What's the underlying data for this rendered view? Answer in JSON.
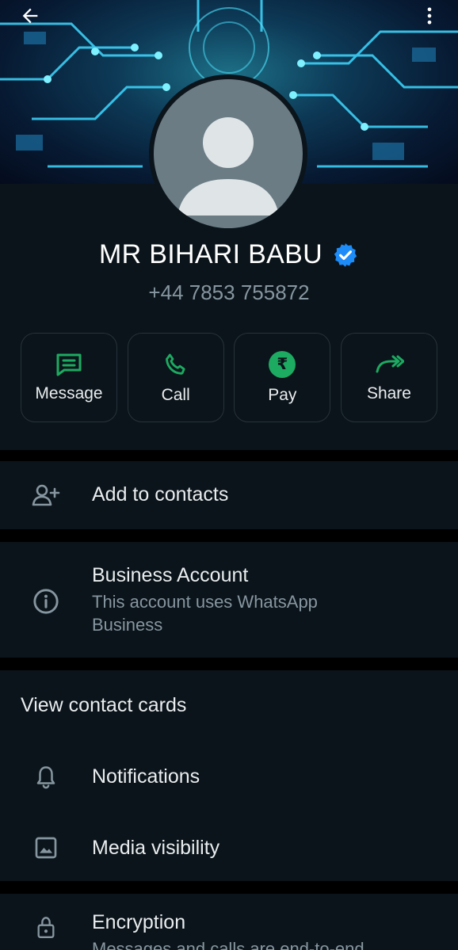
{
  "header": {
    "back_icon": "arrow-left-icon",
    "menu_icon": "more-vertical-icon"
  },
  "profile": {
    "name": "MR BIHARI BABU",
    "phone": "+44 7853 755872",
    "verified_icon": "verified-badge-icon"
  },
  "actions": [
    {
      "label": "Message",
      "icon": "message-icon"
    },
    {
      "label": "Call",
      "icon": "phone-icon"
    },
    {
      "label": "Pay",
      "icon": "rupee-icon",
      "symbol": "₹"
    },
    {
      "label": "Share",
      "icon": "share-icon"
    }
  ],
  "add_contact": {
    "label": "Add to contacts",
    "icon": "add-person-icon"
  },
  "business": {
    "title": "Business Account",
    "subtitle_line1": "This account uses WhatsApp",
    "subtitle_line2": "Business",
    "icon": "info-icon"
  },
  "contact_cards": {
    "label": "View contact cards"
  },
  "notifications": {
    "label": "Notifications",
    "icon": "bell-icon"
  },
  "media": {
    "label": "Media visibility",
    "icon": "image-icon"
  },
  "encryption": {
    "title": "Encryption",
    "subtitle": "Messages and calls are end-to-end",
    "icon": "lock-icon"
  },
  "colors": {
    "accent": "#1daa61",
    "verified": "#1d8cf8",
    "background": "#0b141a",
    "muted_text": "#8696a0"
  }
}
